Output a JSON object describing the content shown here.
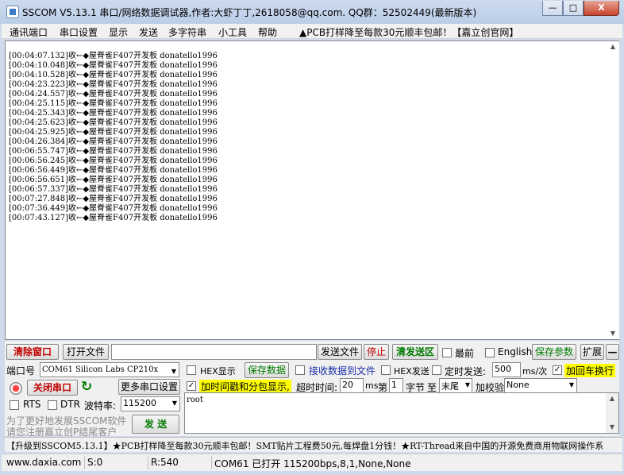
{
  "window": {
    "title": "SSCOM V5.13.1 串口/网络数据调试器,作者:大虾丁丁,2618058@qq.com. QQ群：52502449(最新版本)",
    "min": "—",
    "max": "□",
    "close": "X"
  },
  "menu": {
    "items": [
      "通讯端口",
      "串口设置",
      "显示",
      "发送",
      "多字符串",
      "小工具",
      "帮助"
    ],
    "promo": "▲PCB打样降至每款30元顺丰包邮！【嘉立创官网】"
  },
  "receive": {
    "lines": [
      "[00:04:07.132]收←◆屋脊雀F407开发板 donatello1996",
      "[00:04:10.048]收←◆屋脊雀F407开发板 donatello1996",
      "[00:04:10.528]收←◆屋脊雀F407开发板 donatello1996",
      "[00:04:23.223]收←◆屋脊雀F407开发板 donatello1996",
      "[00:04:24.557]收←◆屋脊雀F407开发板 donatello1996",
      "[00:04:25.115]收←◆屋脊雀F407开发板 donatello1996",
      "[00:04:25.343]收←◆屋脊雀F407开发板 donatello1996",
      "[00:04:25.623]收←◆屋脊雀F407开发板 donatello1996",
      "[00:04:25.925]收←◆屋脊雀F407开发板 donatello1996",
      "[00:04:26.384]收←◆屋脊雀F407开发板 donatello1996",
      "[00:06:55.747]收←◆屋脊雀F407开发板 donatello1996",
      "[00:06:56.245]收←◆屋脊雀F407开发板 donatello1996",
      "[00:06:56.449]收←◆屋脊雀F407开发板 donatello1996",
      "[00:06:56.651]收←◆屋脊雀F407开发板 donatello1996",
      "[00:06:57.337]收←◆屋脊雀F407开发板 donatello1996",
      "[00:07:27.848]收←◆屋脊雀F407开发板 donatello1996",
      "[00:07:36.449]收←◆屋脊雀F407开发板 donatello1996",
      "[00:07:43.127]收←◆屋脊雀F407开发板 donatello1996"
    ]
  },
  "toolbar1": {
    "clear": "清除窗口",
    "open_file": "打开文件",
    "send_file": "发送文件",
    "stop": "停止",
    "clear_send": "清发送区",
    "topmost": "最前",
    "english": "English",
    "save_params": "保存参数",
    "expand": "扩展",
    "collapse": "—"
  },
  "row2": {
    "port_label": "端口号",
    "port_value": "COM61 Silicon Labs CP210x",
    "hex_display": "HEX显示",
    "save_data": "保存数据",
    "recv_to_file": "接收数据到文件",
    "hex_send": "HEX发送",
    "timed_send": "定时发送:",
    "interval": "500",
    "interval_unit": "ms/次",
    "add_crlf": "加回车换行"
  },
  "row3": {
    "close_port": "关闭串口",
    "more_settings": "更多串口设置",
    "add_timestamp": "加时间戳和分包显示,",
    "timeout_label": "超时时间:",
    "timeout": "20",
    "ms": "ms",
    "nth": "第",
    "byte_no": "1",
    "byte": "字节",
    "to": "至",
    "end": "末尾",
    "checksum_label": "加校验",
    "checksum": "None"
  },
  "row4": {
    "rts": "RTS",
    "dtr": "DTR",
    "baud_label": "波特率:",
    "baud": "115200"
  },
  "send": {
    "text": "root",
    "hint1": "为了更好地发展SSCOM软件",
    "hint2": "请您注册嘉立创P结尾客户",
    "button": "发 送"
  },
  "ticker": "【升级到SSCOM5.13.1】★PCB打样降至每款30元顺丰包邮！SMT贴片工程费50元,每焊盘1分钱！★RT-Thread来自中国的开源免费商用物联网操作系",
  "status": {
    "site": "www.daxia.com",
    "sent": "S:0",
    "recv": "R:540",
    "port": "COM61 已打开  115200bps,8,1,None,None"
  },
  "colors": {
    "title_bg": "#b9cde6",
    "accent_red": "#c00000",
    "accent_green": "#007a00",
    "highlight": "#ffff00"
  }
}
